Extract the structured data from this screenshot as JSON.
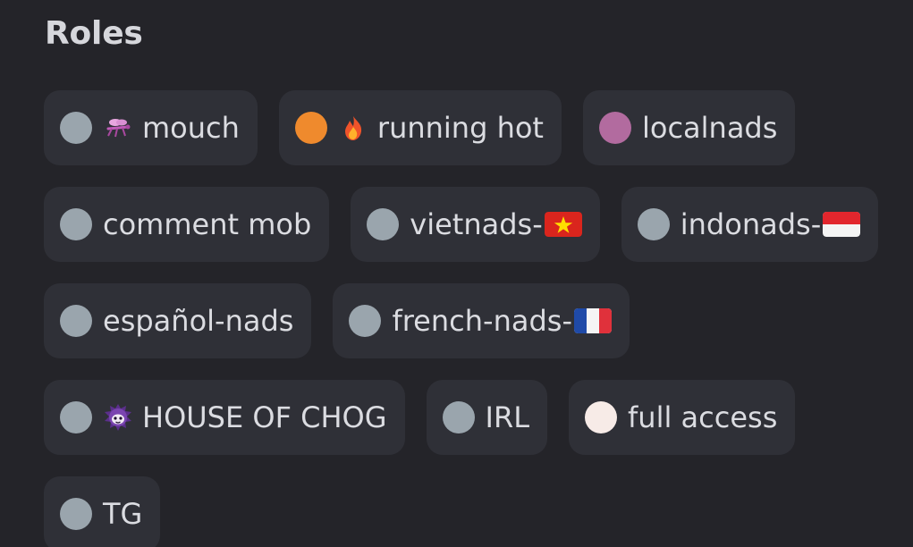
{
  "heading": "Roles",
  "colors": {
    "background": "#242429",
    "chip": "#2f3037",
    "default_dot": "#9aa5ad"
  },
  "roles": [
    {
      "label": "mouch",
      "color": "#9aa5ad",
      "icon": "mosquito-icon"
    },
    {
      "label": "running hot",
      "color": "#ef8a2d",
      "icon": "fire-icon"
    },
    {
      "label": "localnads",
      "color": "#b26b9f"
    },
    {
      "label": "comment mob",
      "color": "#9aa5ad"
    },
    {
      "label": "vietnads-",
      "color": "#9aa5ad",
      "icon": "vietnam-flag-icon"
    },
    {
      "label": "indonads-",
      "color": "#9aa5ad",
      "icon": "indonesia-flag-icon"
    },
    {
      "label": "español-nads",
      "color": "#9aa5ad"
    },
    {
      "label": "french-nads-",
      "color": "#9aa5ad",
      "icon": "france-flag-icon"
    },
    {
      "label": "HOUSE OF CHOG",
      "color": "#9aa5ad",
      "icon": "chog-mascot-icon"
    },
    {
      "label": "IRL",
      "color": "#9aa5ad"
    },
    {
      "label": "full access",
      "color": "#f7ebe7"
    },
    {
      "label": "TG",
      "color": "#9aa5ad"
    }
  ]
}
